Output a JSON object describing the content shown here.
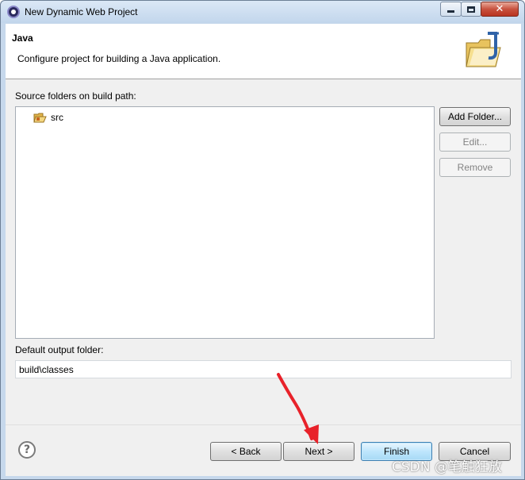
{
  "window": {
    "title": "New Dynamic Web Project",
    "close_glyph": "✕"
  },
  "header": {
    "title": "Java",
    "description": "Configure project for building a Java application.",
    "icon": "java-folder-icon"
  },
  "source_folders": {
    "label": "Source folders on build path:",
    "items": [
      {
        "label": "src",
        "icon": "source-folder-icon"
      }
    ],
    "buttons": {
      "add": "Add Folder...",
      "edit": "Edit...",
      "remove": "Remove"
    }
  },
  "output": {
    "label": "Default output folder:",
    "value": "build\\classes"
  },
  "footer": {
    "help_glyph": "?",
    "back": "< Back",
    "next": "Next >",
    "finish": "Finish",
    "cancel": "Cancel"
  },
  "watermark": "CSDN @笔触狂放",
  "colors": {
    "annotation_arrow": "#e8222a",
    "default_button": "#3c7fb1"
  }
}
